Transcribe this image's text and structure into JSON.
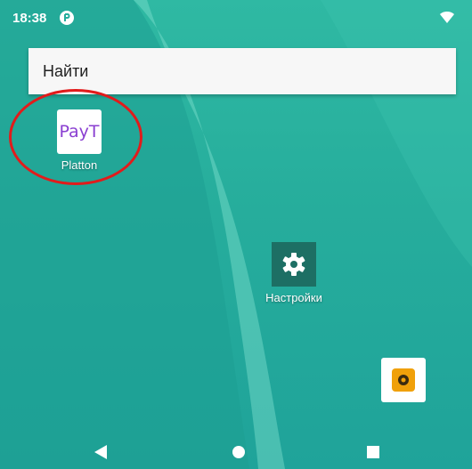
{
  "status_bar": {
    "time": "18:38"
  },
  "search": {
    "label": "Найти"
  },
  "apps": [
    {
      "name": "Platton",
      "icon_text": "PayT",
      "icon_text_color": "#8a3fd1"
    },
    {
      "name": "Настройки",
      "icon": "gear-icon"
    },
    {
      "name": "",
      "icon": "camera-icon"
    }
  ],
  "colors": {
    "highlight": "#e21b1b",
    "wallpaper": "#26ad9c"
  }
}
